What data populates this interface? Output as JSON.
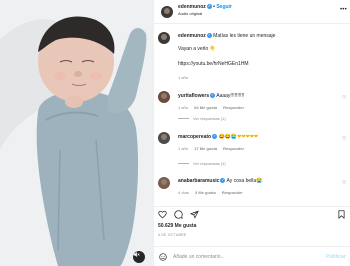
{
  "post": {
    "sound_icon": "speaker-muted-icon"
  },
  "header": {
    "username": "edenmunoz",
    "separator": "•",
    "follow_label": "Seguir",
    "subtitle": "Audio original",
    "more_icon": "more-horizontal-icon",
    "more_label": "•••"
  },
  "caption": {
    "username": "edenmunoz",
    "line1": "Matías les tiene un mensaje",
    "line2": "Vayan a verlo 👇",
    "link": "https://youtu.be/hrNeHGEn1HM",
    "time": "1 año"
  },
  "comments": [
    {
      "username": "yuritaflowers",
      "text": "Aaaay!!!!!!!!!!",
      "time": "1 año",
      "likes": "94 Me gusta",
      "reply": "Responder",
      "replies": "Ver respuestas (1)"
    },
    {
      "username": "marcopereato",
      "text": "😂😂😭❤❤❤❤❤",
      "time": "1 año",
      "likes": "17 Me gusta",
      "reply": "Responder",
      "replies": "Ver respuestas (1)"
    },
    {
      "username": "anabarbaramusic",
      "text": "Ay cosa bella😭",
      "time": "4 días",
      "likes": "3 Me gusta",
      "reply": "Responder"
    }
  ],
  "actions": {
    "like_icon": "heart-icon",
    "comment_icon": "comment-icon",
    "share_icon": "paper-plane-icon",
    "save_icon": "bookmark-icon"
  },
  "stats": {
    "likes": "50.629 Me gusta",
    "date": "4 DE OCTUBRE"
  },
  "add_comment": {
    "placeholder": "Añade un comentario...",
    "publish": "Publicar",
    "emoji_icon": "smiley-icon"
  },
  "colors": {
    "accent": "#0095f6",
    "verified": "#3897f0",
    "muted": "#8e8e8e"
  }
}
